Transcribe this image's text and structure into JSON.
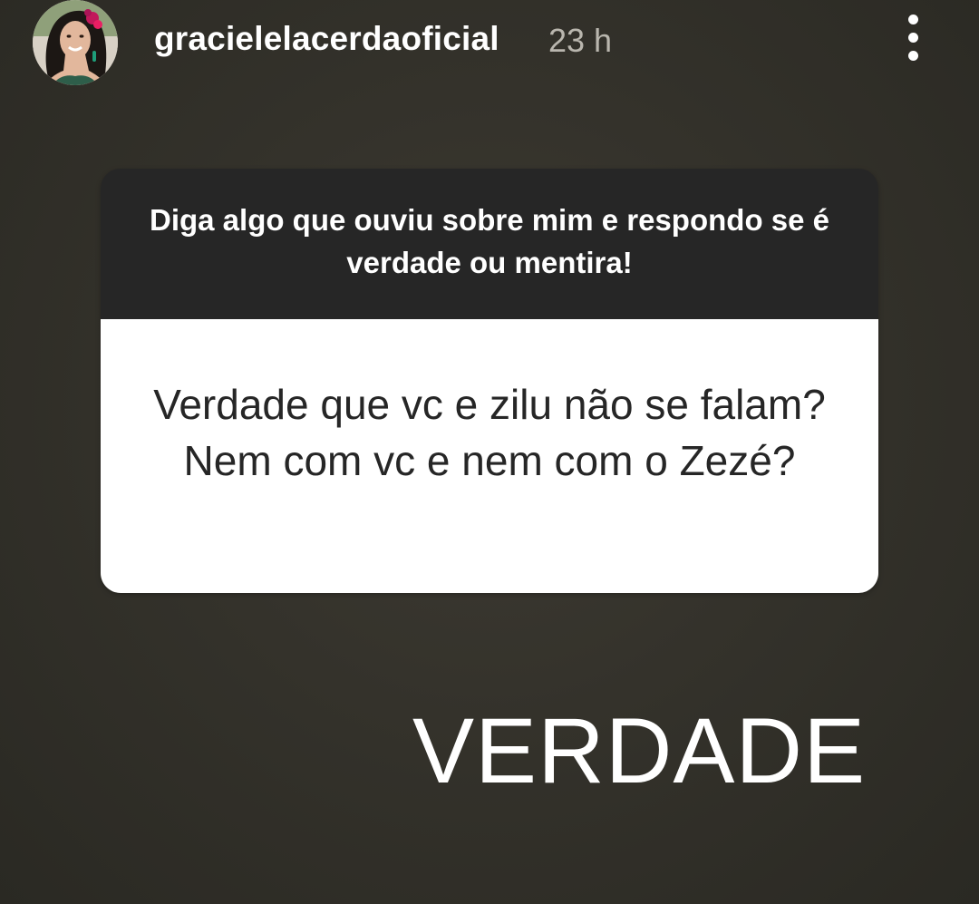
{
  "header": {
    "username": "gracielelacerdaoficial",
    "time": "23 h",
    "avatar_icon": "profile-photo",
    "more_icon": "vertical-dots-icon"
  },
  "question_sticker": {
    "prompt": "Diga algo que ouviu sobre mim e respondo se é verdade ou mentira!",
    "answer": "Verdade que vc e zilu não se falam? Nem com vc e nem com o Zezé?"
  },
  "reply": {
    "text": "VERDADE"
  },
  "colors": {
    "background": "#34322b",
    "card_header": "#262626",
    "card_body": "#ffffff",
    "text_light": "#ffffff",
    "text_dark": "#262626",
    "time_text": "#b9b6ae",
    "avatar_flower": "#c2185b"
  }
}
